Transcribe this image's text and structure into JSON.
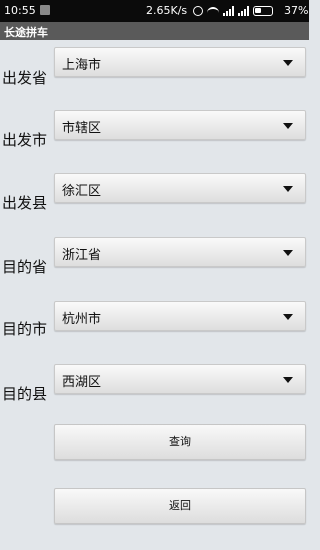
{
  "status_bar": {
    "time": "10:55",
    "network_speed": "2.65K/s",
    "battery_percent": "37%"
  },
  "app": {
    "title": "长途拼车"
  },
  "form": {
    "rows": [
      {
        "label": "出发省",
        "value": "上海市"
      },
      {
        "label": "出发市",
        "value": "市辖区"
      },
      {
        "label": "出发县",
        "value": "徐汇区"
      },
      {
        "label": "目的省",
        "value": "浙江省"
      },
      {
        "label": "目的市",
        "value": "杭州市"
      },
      {
        "label": "目的县",
        "value": "西湖区"
      }
    ],
    "query_button": "查询",
    "back_button": "返回"
  }
}
